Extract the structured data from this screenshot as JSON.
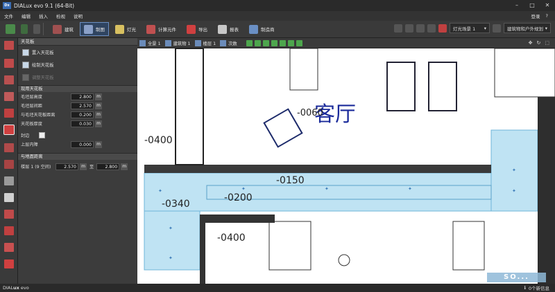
{
  "app": {
    "title": "DIALux evo 9.1  (64-Bit)",
    "logo": "Dx"
  },
  "menu": {
    "items": [
      "文件",
      "编辑",
      "插入",
      "检视",
      "说明"
    ],
    "login": "登录",
    "help": "?"
  },
  "toolbar": {
    "buttons": [
      {
        "label": "建筑"
      },
      {
        "label": "制图"
      },
      {
        "label": "灯光"
      },
      {
        "label": "计算元件"
      },
      {
        "label": "导出"
      },
      {
        "label": "报表"
      },
      {
        "label": "制造商"
      }
    ],
    "light_scene": "灯光场景 1",
    "view_scope": "建筑物和户外规划"
  },
  "panel": {
    "title": "天花板",
    "actions": [
      {
        "label": "置入天花板",
        "enabled": true
      },
      {
        "label": "绘制天花板",
        "enabled": true
      },
      {
        "label": "调整天花板",
        "enabled": false
      }
    ],
    "section_title": "现用天花板",
    "props": [
      {
        "label": "毛坯层高度",
        "value": "2.800",
        "unit": "m"
      },
      {
        "label": "毛坯层间距",
        "value": "2.570",
        "unit": "m"
      },
      {
        "label": "与毛坯天花板距离",
        "value": "0.200",
        "unit": "m"
      },
      {
        "label": "天花板厚度",
        "value": "0.030",
        "unit": "m"
      }
    ],
    "insulation_label": "封边",
    "upper_label": "上层内障",
    "upper_value": "0.000",
    "upper_unit": "m",
    "floor_section_title": "与地面距离",
    "floor_label": "楼层 1 (9 空间)",
    "floor_value_from": "2.570",
    "floor_unit_from": "m",
    "floor_to": "至",
    "floor_value_to": "2.800",
    "floor_unit_to": "m"
  },
  "viewbar": {
    "items": [
      "全景 1",
      "建筑物 1",
      "楼层 1",
      "次数"
    ]
  },
  "canvas": {
    "room_label": "客厅",
    "levels": [
      "-0400",
      "-0060",
      "-0150",
      "-0200",
      "-0340",
      "-0400"
    ]
  },
  "status": {
    "brand_light": "DIAL",
    "brand_bold": "ux",
    "brand_suffix": " evo",
    "messages": "0个新信息"
  },
  "watermark": "SO..."
}
